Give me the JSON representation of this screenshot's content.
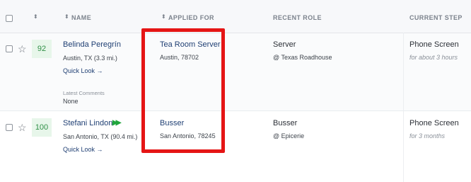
{
  "header": {
    "name_label": "NAME",
    "applied_for_label": "APPLIED FOR",
    "recent_role_label": "RECENT ROLE",
    "current_step_label": "CURRENT STEP",
    "sort_icon": "sort-arrows-icon"
  },
  "candidates": [
    {
      "score": "92",
      "name": "Belinda Peregrín",
      "location": "Austin, TX (3.3 mi.)",
      "quick_look": "Quick Look →",
      "applied_title": "Tea Room Server",
      "applied_location": "Austin, 78702",
      "recent_role": "Server",
      "recent_company": "@ Texas Roadhouse",
      "current_step": "Phone Screen",
      "step_time": "for about 3 hours",
      "comments_label": "Latest Comments",
      "comments_value": "None"
    },
    {
      "score": "100",
      "name": "Stefani Lindon",
      "fast_forward_icon": "fast-forward-icon",
      "location": "San Antonio, TX (90.4 mi.)",
      "quick_look": "Quick Look →",
      "applied_title": "Busser",
      "applied_location": "San Antonio, 78245",
      "recent_role": "Busser",
      "recent_company": "@ Epicerie",
      "current_step": "Phone Screen",
      "step_time": "for 3 months"
    }
  ],
  "colors": {
    "highlight": "#e51515",
    "score_bg": "#e7f6ea",
    "score_text": "#2f8f46",
    "link": "#1f3f73"
  }
}
